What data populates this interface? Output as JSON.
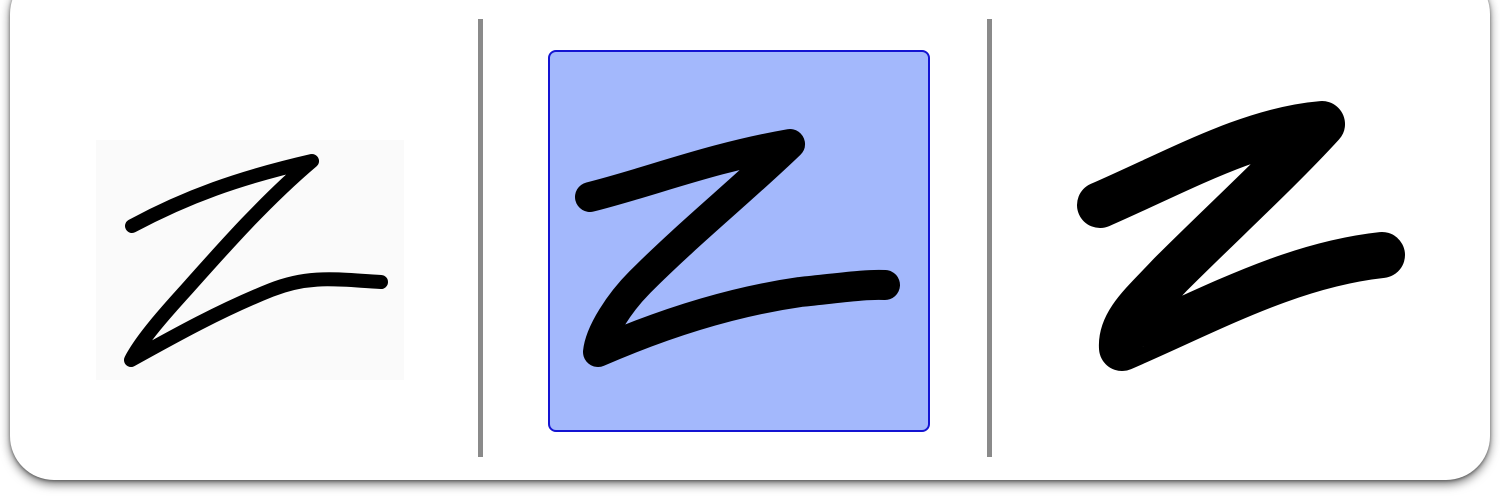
{
  "stroke_width_picker": {
    "options": [
      {
        "id": "thin",
        "icon": "z-stroke-thin-icon",
        "selected": false
      },
      {
        "id": "medium",
        "icon": "z-stroke-medium-icon",
        "selected": true
      },
      {
        "id": "thick",
        "icon": "z-stroke-thick-icon",
        "selected": false
      }
    ],
    "colors": {
      "stroke": "#000000",
      "selected_fill": "#a3b8fc",
      "selected_border": "#1414d2",
      "unselected_bg": "#fafafa",
      "divider": "#8a8a8a"
    }
  }
}
